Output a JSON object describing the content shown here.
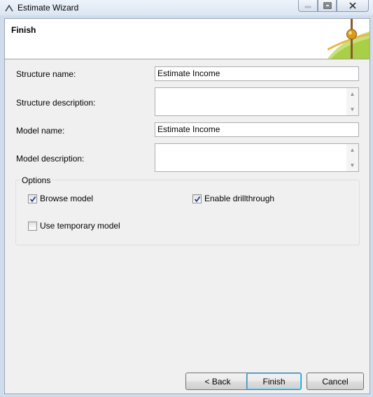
{
  "window": {
    "title": "Estimate Wizard"
  },
  "header": {
    "title": "Finish"
  },
  "form": {
    "structure_name": {
      "label": "Structure name:",
      "value": "Estimate Income"
    },
    "structure_description": {
      "label": "Structure description:",
      "value": ""
    },
    "model_name": {
      "label": "Model name:",
      "value": "Estimate Income"
    },
    "model_description": {
      "label": "Model description:",
      "value": ""
    }
  },
  "options": {
    "title": "Options",
    "browse_model": {
      "label": "Browse model",
      "checked": true
    },
    "enable_drillthrough": {
      "label": "Enable drillthrough",
      "checked": true
    },
    "use_temporary_model": {
      "label": "Use temporary model",
      "checked": false
    }
  },
  "buttons": {
    "back": "< Back",
    "finish": "Finish",
    "cancel": "Cancel"
  }
}
